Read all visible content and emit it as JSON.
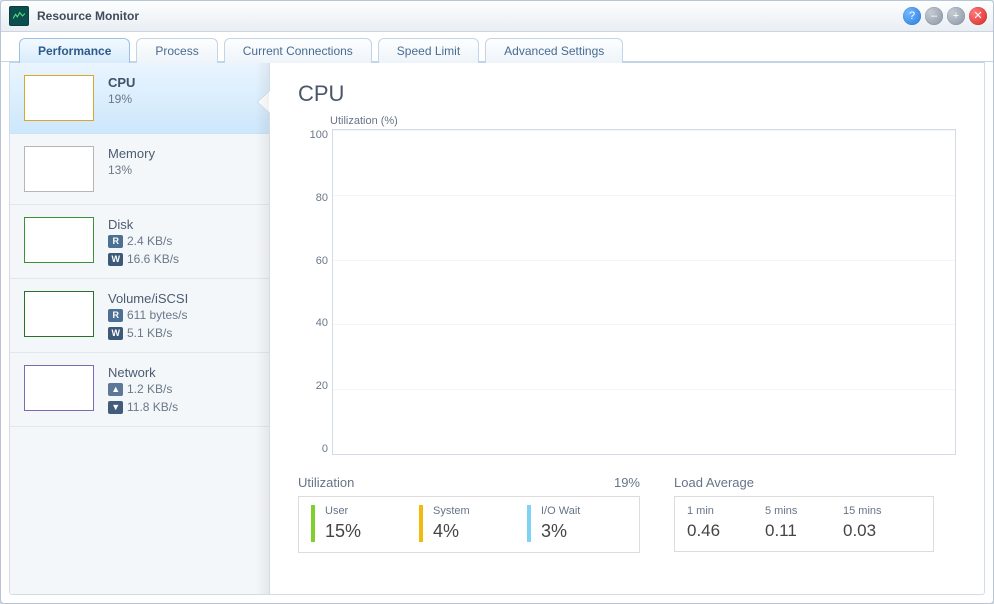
{
  "window": {
    "title": "Resource Monitor"
  },
  "tabs": [
    {
      "label": "Performance",
      "active": true
    },
    {
      "label": "Process",
      "active": false
    },
    {
      "label": "Current Connections",
      "active": false
    },
    {
      "label": "Speed Limit",
      "active": false
    },
    {
      "label": "Advanced Settings",
      "active": false
    }
  ],
  "sidebar": {
    "cpu": {
      "name": "CPU",
      "percent": "19%"
    },
    "memory": {
      "name": "Memory",
      "percent": "13%"
    },
    "disk": {
      "name": "Disk",
      "read": "2.4 KB/s",
      "write": "16.6 KB/s"
    },
    "volume": {
      "name": "Volume/iSCSI",
      "read": "611 bytes/s",
      "write": "5.1 KB/s"
    },
    "network": {
      "name": "Network",
      "up": "1.2 KB/s",
      "down": "11.8 KB/s"
    }
  },
  "main": {
    "title": "CPU",
    "chart_label": "Utilization (%)",
    "utilization": {
      "head": "Utilization",
      "total": "19%",
      "user": {
        "label": "User",
        "value": "15%"
      },
      "system": {
        "label": "System",
        "value": "4%"
      },
      "iowait": {
        "label": "I/O Wait",
        "value": "3%"
      }
    },
    "loadavg": {
      "head": "Load Average",
      "m1": {
        "label": "1 min",
        "value": "0.46"
      },
      "m5": {
        "label": "5 mins",
        "value": "0.11"
      },
      "m15": {
        "label": "15 mins",
        "value": "0.03"
      }
    }
  },
  "badge_labels": {
    "r": "R",
    "w": "W",
    "up": "▲",
    "down": "▼"
  },
  "chart_data": {
    "type": "line",
    "title": "CPU",
    "ylabel": "Utilization (%)",
    "xlabel": "",
    "ylim": [
      0,
      100
    ],
    "yticks": [
      0,
      20,
      40,
      60,
      80,
      100
    ],
    "series": [
      {
        "name": "Utilization",
        "values": []
      }
    ],
    "note": "Chart area is empty in the screenshot; no plotted data points visible."
  }
}
